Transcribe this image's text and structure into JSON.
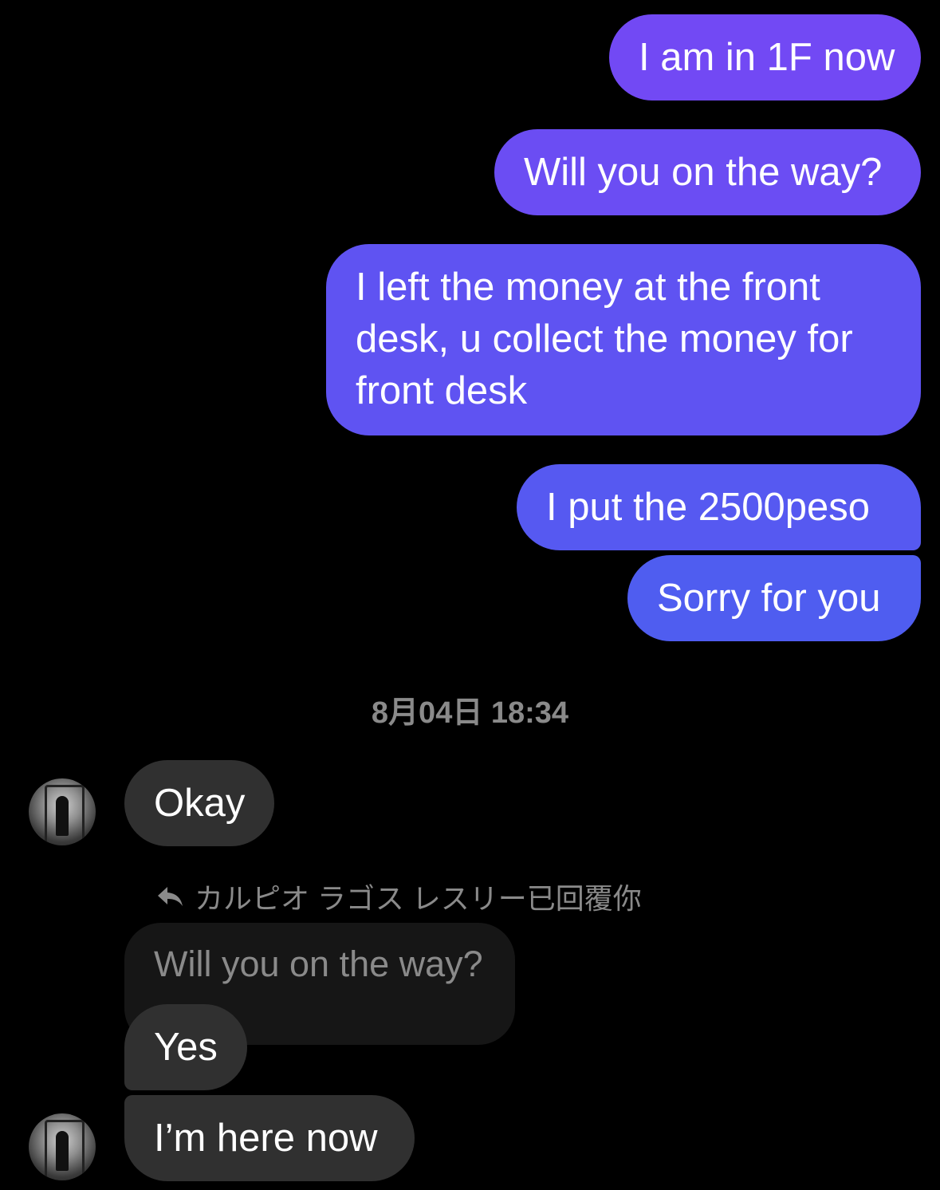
{
  "outgoing": [
    {
      "text": "I am in 1F now"
    },
    {
      "text": "Will you on the way?"
    },
    {
      "lines": [
        "I left the money at the front",
        "desk, u collect the money for",
        "front desk"
      ]
    },
    {
      "text": "I put the 2500peso"
    },
    {
      "text": "Sorry for you"
    }
  ],
  "timestamp": "8月04日 18:34",
  "incoming": {
    "okay": "Okay",
    "reply_label": "カルピオ ラゴス レスリー已回覆你",
    "quoted": "Will you on the way?",
    "yes": "Yes",
    "here": "I’m here now"
  },
  "colors": {
    "background": "#000000",
    "outgoing_top": "#7249f4",
    "outgoing_bottom": "#4f5df0",
    "incoming": "#303030",
    "quoted": "#161616",
    "muted_text": "#8a8a8a"
  },
  "icons": {
    "reply": "reply-arrow-icon",
    "avatar": "contact-avatar"
  }
}
